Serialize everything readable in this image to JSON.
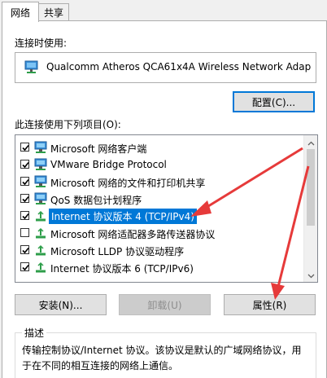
{
  "tabs": [
    {
      "label": "网络",
      "active": true
    },
    {
      "label": "共享",
      "active": false
    }
  ],
  "connect_using_label": "连接时使用:",
  "adapter": {
    "name": "Qualcomm Atheros QCA61x4A Wireless Network Adap",
    "icon": "network-adapter-icon"
  },
  "configure_button": "配置(C)...",
  "items_label": "此连接使用下列项目(O):",
  "items": [
    {
      "label": "Microsoft 网络客户端",
      "checked": true,
      "icon": "network-client-icon",
      "selected": false
    },
    {
      "label": "VMware Bridge Protocol",
      "checked": true,
      "icon": "network-service-icon",
      "selected": false
    },
    {
      "label": "Microsoft 网络的文件和打印机共享",
      "checked": true,
      "icon": "network-service-icon",
      "selected": false
    },
    {
      "label": "QoS 数据包计划程序",
      "checked": true,
      "icon": "network-service-icon",
      "selected": false
    },
    {
      "label": "Internet 协议版本 4 (TCP/IPv4)",
      "checked": true,
      "icon": "protocol-icon",
      "selected": true
    },
    {
      "label": "Microsoft 网络适配器多路传送器协议",
      "checked": false,
      "icon": "protocol-icon",
      "selected": false
    },
    {
      "label": "Microsoft LLDP 协议驱动程序",
      "checked": true,
      "icon": "protocol-icon",
      "selected": false
    },
    {
      "label": "Internet 协议版本 6 (TCP/IPv6)",
      "checked": true,
      "icon": "protocol-icon",
      "selected": false
    }
  ],
  "buttons": {
    "install": "安装(N)...",
    "uninstall": "卸载(U)",
    "properties": "属性(R)"
  },
  "description": {
    "title": "描述",
    "text": "传输控制协议/Internet 协议。该协议是默认的广域网络协议，用于在不同的相互连接的网络上通信。"
  },
  "colors": {
    "selection": "#0078d7",
    "annotation_arrow": "#e63a3a"
  }
}
